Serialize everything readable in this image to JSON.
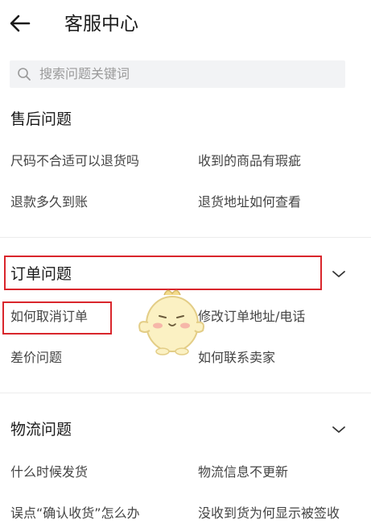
{
  "header": {
    "title": "客服中心",
    "back_icon": "arrow-left-icon"
  },
  "search": {
    "placeholder": "搜索问题关键词",
    "icon": "search-icon"
  },
  "sections": [
    {
      "title": "售后问题",
      "items": [
        "尺码不合适可以退货吗",
        "收到的商品有瑕疵",
        "退款多久到账",
        "退货地址如何查看"
      ]
    },
    {
      "title": "订单问题",
      "items": [
        "如何取消订单",
        "修改订单地址/电话",
        "差价问题",
        "如何联系卖家"
      ],
      "expand_icon": "chevron-down-icon"
    },
    {
      "title": "物流问题",
      "items": [
        "什么时候发货",
        "物流信息不更新",
        "误点“确认收货”怎么办",
        "没收到货为何显示被签收"
      ],
      "expand_icon": "chevron-down-icon"
    }
  ],
  "colors": {
    "highlight": "#d9262c",
    "search_bg": "#f2f3f5",
    "divider": "#ececec"
  }
}
